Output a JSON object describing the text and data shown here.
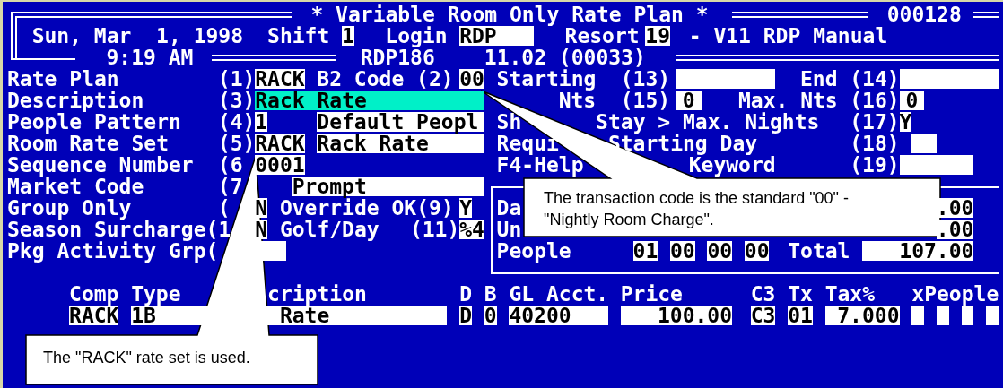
{
  "screen": {
    "lines": [
      {
        "segments": [
          {
            "kind": "title",
            "text": "* Variable Room Only Rate Plan *"
          },
          {
            "kind": "info",
            "text": "000128"
          }
        ]
      },
      {
        "segments": [
          {
            "kind": "info",
            "text": "Sun, Mar  1, 1998"
          },
          {
            "kind": "label",
            "text": "Shift"
          },
          {
            "kind": "field",
            "text": "1"
          },
          {
            "kind": "label",
            "text": "Login"
          },
          {
            "kind": "field",
            "text": "RDP"
          },
          {
            "kind": "label",
            "text": "Resort"
          },
          {
            "kind": "field",
            "text": "19"
          },
          {
            "kind": "info",
            "text": "- V11 RDP Manual"
          }
        ]
      },
      {
        "segments": [
          {
            "kind": "info",
            "text": "9:19 AM"
          },
          {
            "kind": "info",
            "text": "RDP186"
          },
          {
            "kind": "info",
            "text": "11.02 (00033)"
          }
        ]
      },
      {
        "segments": [
          {
            "kind": "label",
            "text": "Rate Plan"
          },
          {
            "kind": "label",
            "text": "(1)"
          },
          {
            "kind": "field",
            "text": "RACK"
          },
          {
            "kind": "label",
            "text": "B2 Code (2)"
          },
          {
            "kind": "field",
            "text": "00"
          },
          {
            "kind": "label",
            "text": "Starting"
          },
          {
            "kind": "label",
            "text": "(13)"
          },
          {
            "kind": "blank"
          },
          {
            "kind": "label",
            "text": "End"
          },
          {
            "kind": "label",
            "text": "(14)"
          },
          {
            "kind": "blank"
          }
        ]
      },
      {
        "segments": [
          {
            "kind": "label",
            "text": "Description"
          },
          {
            "kind": "label",
            "text": "(3)"
          },
          {
            "kind": "active",
            "text": "Rack Rate"
          },
          {
            "kind": "label",
            "text": "Nts"
          },
          {
            "kind": "label",
            "text": "(15)"
          },
          {
            "kind": "field",
            "text": "0"
          },
          {
            "kind": "label",
            "text": "Max. Nts"
          },
          {
            "kind": "label",
            "text": "(16)"
          },
          {
            "kind": "field",
            "text": "0"
          }
        ]
      },
      {
        "segments": [
          {
            "kind": "label",
            "text": "People Pattern"
          },
          {
            "kind": "label",
            "text": "(4)"
          },
          {
            "kind": "field",
            "text": "1"
          },
          {
            "kind": "field",
            "text": "Default Peopl"
          },
          {
            "kind": "label",
            "text": "Sh"
          },
          {
            "kind": "label",
            "text": "Stay > Max. Nights"
          },
          {
            "kind": "label",
            "text": "(17)"
          },
          {
            "kind": "field",
            "text": "Y"
          }
        ]
      },
      {
        "segments": [
          {
            "kind": "label",
            "text": "Room Rate Set"
          },
          {
            "kind": "label",
            "text": "(5)"
          },
          {
            "kind": "field",
            "text": "RACK"
          },
          {
            "kind": "field",
            "text": "Rack Rate"
          },
          {
            "kind": "label",
            "text": "Requi"
          },
          {
            "kind": "label",
            "text": "Starting Day"
          },
          {
            "kind": "label",
            "text": "(18)"
          },
          {
            "kind": "blank"
          }
        ]
      },
      {
        "segments": [
          {
            "kind": "label",
            "text": "Sequence Number"
          },
          {
            "kind": "label",
            "text": "(6"
          },
          {
            "kind": "field",
            "text": "0001"
          },
          {
            "kind": "label",
            "text": "F4-Help"
          },
          {
            "kind": "label",
            "text": "Keyword"
          },
          {
            "kind": "label",
            "text": "(19)"
          },
          {
            "kind": "blank"
          }
        ]
      },
      {
        "segments": [
          {
            "kind": "label",
            "text": "Market Code"
          },
          {
            "kind": "label",
            "text": "(7"
          },
          {
            "kind": "field",
            "text": "Prompt"
          }
        ]
      },
      {
        "segments": [
          {
            "kind": "label",
            "text": "Group Only"
          },
          {
            "kind": "label",
            "text": "("
          },
          {
            "kind": "field",
            "text": "N"
          },
          {
            "kind": "label",
            "text": "Override OK(9)"
          },
          {
            "kind": "field",
            "text": "Y"
          },
          {
            "kind": "label",
            "text": "Da"
          },
          {
            "kind": "field",
            "text": ".00"
          }
        ]
      },
      {
        "segments": [
          {
            "kind": "label",
            "text": "Season Surcharge(1"
          },
          {
            "kind": "field",
            "text": "N"
          },
          {
            "kind": "label",
            "text": "Golf/Day"
          },
          {
            "kind": "label",
            "text": "(11)"
          },
          {
            "kind": "field",
            "text": "%4"
          },
          {
            "kind": "label",
            "text": "Un"
          },
          {
            "kind": "field",
            "text": ".00"
          }
        ]
      },
      {
        "segments": [
          {
            "kind": "label",
            "text": "Pkg Activity Grp("
          },
          {
            "kind": "blank"
          },
          {
            "kind": "label",
            "text": "People"
          },
          {
            "kind": "field",
            "text": "01"
          },
          {
            "kind": "field",
            "text": "00"
          },
          {
            "kind": "field",
            "text": "00"
          },
          {
            "kind": "field",
            "text": "00"
          },
          {
            "kind": "label",
            "text": "Total"
          },
          {
            "kind": "field",
            "text": "107.00"
          }
        ]
      },
      {
        "segments": [
          {
            "kind": "heading",
            "text": "Comp"
          },
          {
            "kind": "heading",
            "text": "Type"
          },
          {
            "kind": "heading",
            "text": "cription"
          },
          {
            "kind": "heading",
            "text": "D"
          },
          {
            "kind": "heading",
            "text": "B"
          },
          {
            "kind": "heading",
            "text": "GL Acct."
          },
          {
            "kind": "heading",
            "text": "Price"
          },
          {
            "kind": "heading",
            "text": "C3"
          },
          {
            "kind": "heading",
            "text": "Tx"
          },
          {
            "kind": "heading",
            "text": "Tax%"
          },
          {
            "kind": "heading",
            "text": "xPeople"
          }
        ]
      },
      {
        "segments": [
          {
            "kind": "field",
            "text": "RACK"
          },
          {
            "kind": "field",
            "text": "1B"
          },
          {
            "kind": "field",
            "text": "Rate"
          },
          {
            "kind": "field",
            "text": "D"
          },
          {
            "kind": "field",
            "text": "0"
          },
          {
            "kind": "field",
            "text": "40200"
          },
          {
            "kind": "field",
            "text": "100.00"
          },
          {
            "kind": "field",
            "text": "C3"
          },
          {
            "kind": "field",
            "text": "01"
          },
          {
            "kind": "field",
            "text": "7.000"
          },
          {
            "kind": "blank"
          },
          {
            "kind": "blank"
          },
          {
            "kind": "blank"
          },
          {
            "kind": "blank"
          }
        ]
      }
    ]
  },
  "callouts": [
    {
      "text": "The transaction code is the standard \"00\" -\n\"Nightly Room Charge\"."
    },
    {
      "text": "The \"RACK\" rate set is used."
    }
  ]
}
